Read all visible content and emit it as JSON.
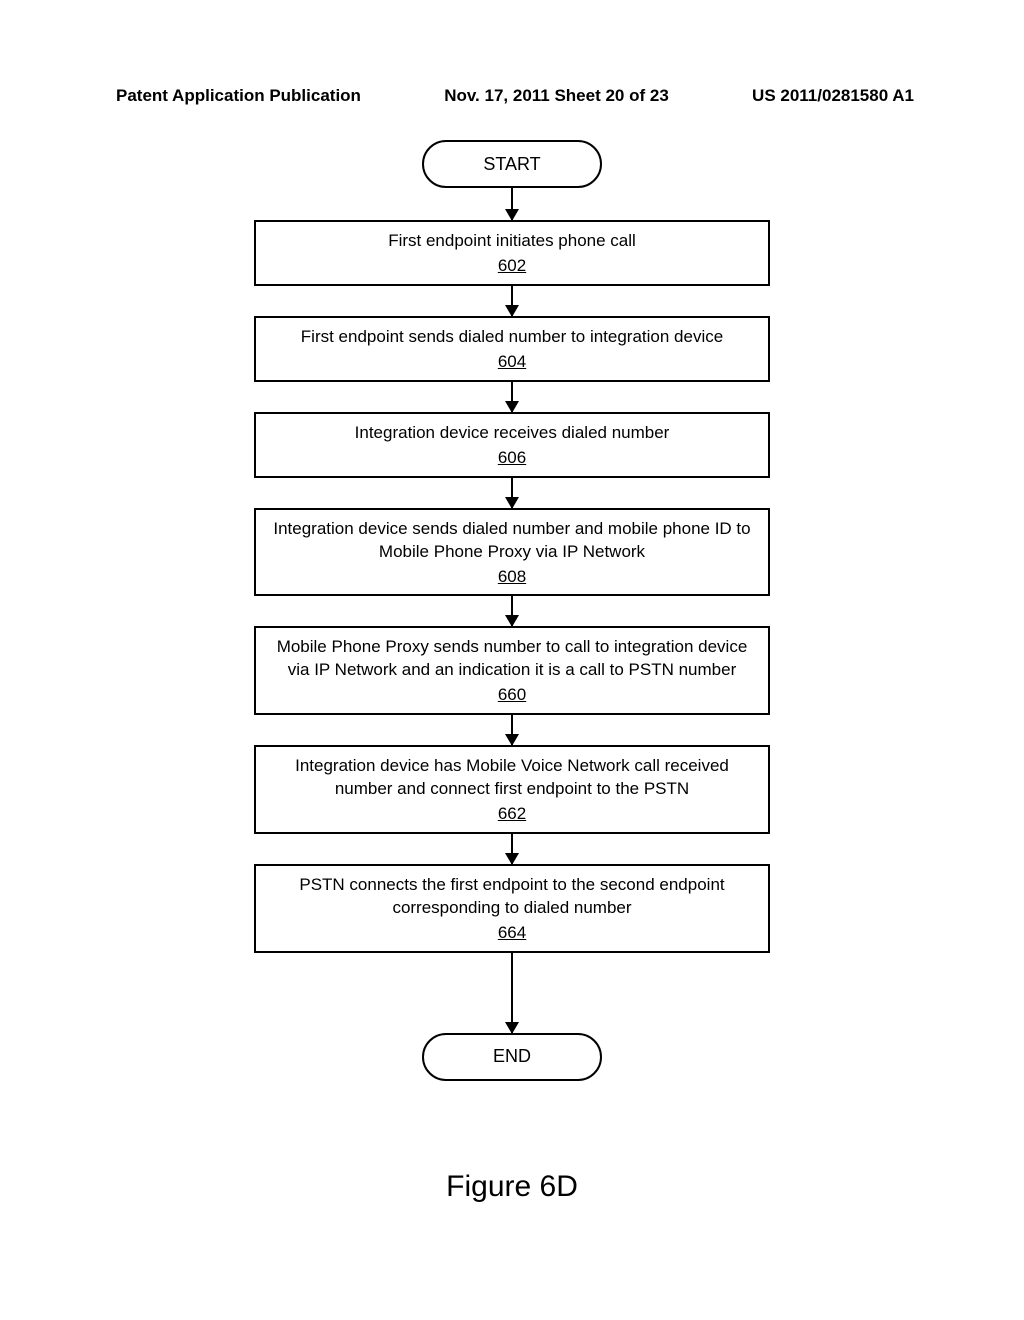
{
  "header": {
    "left": "Patent Application Publication",
    "center": "Nov. 17, 2011  Sheet 20 of 23",
    "right": "US 2011/0281580 A1"
  },
  "flow": {
    "start": "START",
    "steps": [
      {
        "text": "First endpoint initiates phone call",
        "ref": "602"
      },
      {
        "text": "First endpoint sends dialed number to integration device",
        "ref": "604"
      },
      {
        "text": "Integration device receives dialed number",
        "ref": "606"
      },
      {
        "text": "Integration device sends dialed number and mobile phone ID to Mobile Phone Proxy via IP Network",
        "ref": "608"
      },
      {
        "text": "Mobile Phone Proxy sends number to call to integration device via IP Network and an indication it is a call to PSTN number",
        "ref": "660"
      },
      {
        "text": "Integration device has Mobile Voice Network call received number and connect first endpoint to the PSTN",
        "ref": "662"
      },
      {
        "text": "PSTN connects the first endpoint to the second endpoint corresponding to dialed number",
        "ref": "664"
      }
    ],
    "end": "END"
  },
  "figure_label": "Figure 6D"
}
